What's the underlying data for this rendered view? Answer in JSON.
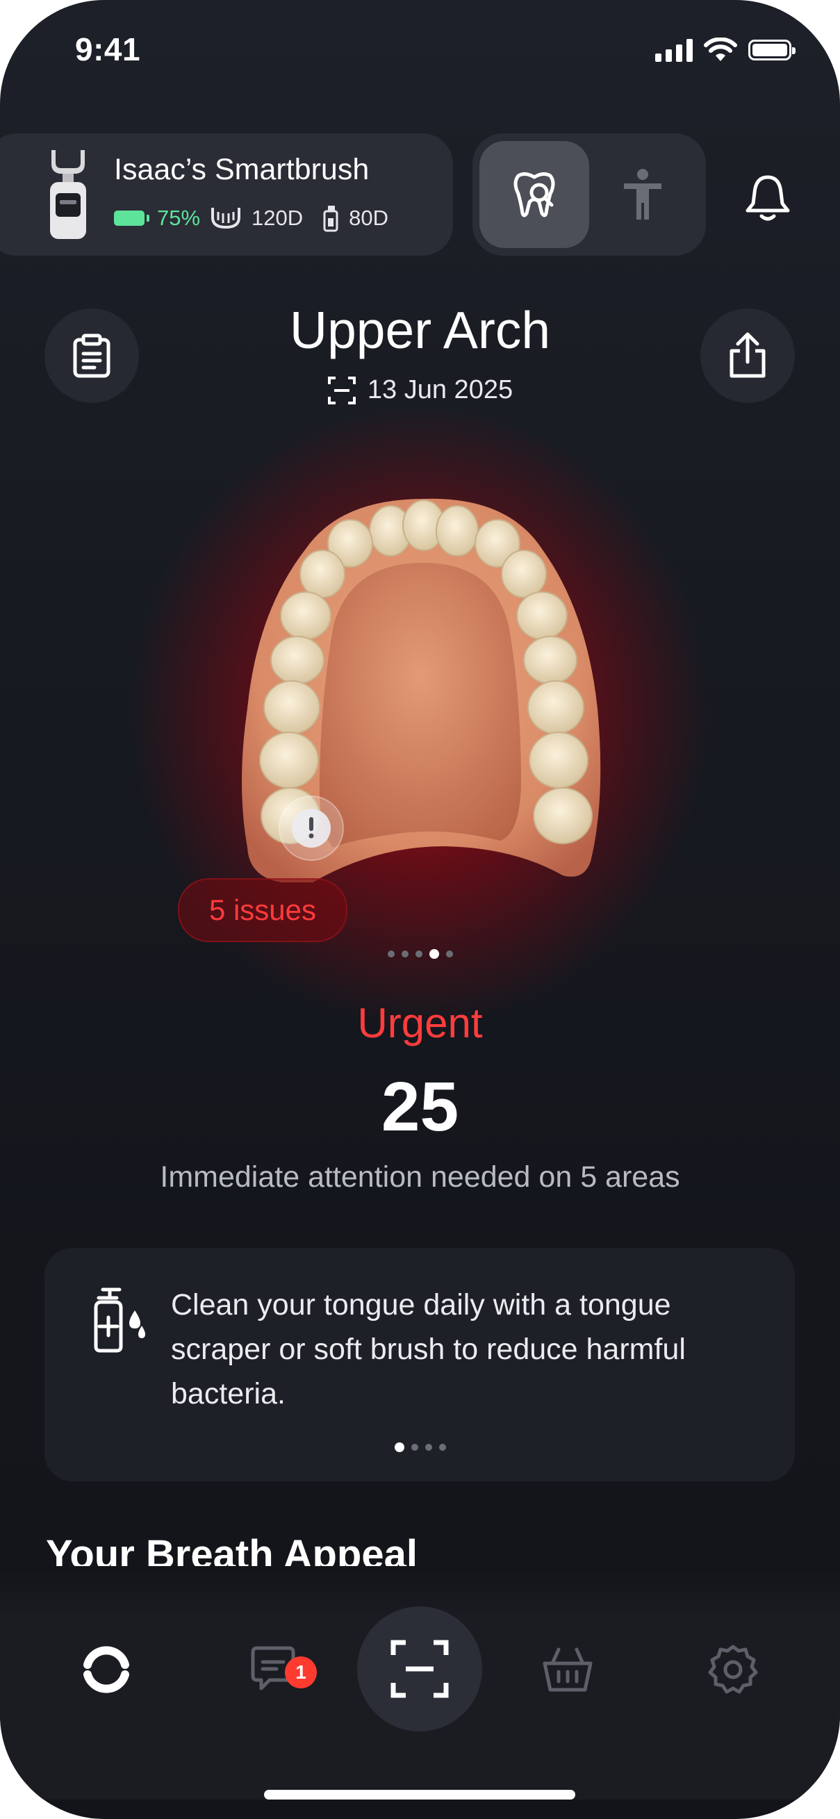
{
  "status_bar": {
    "time": "9:41"
  },
  "device": {
    "name": "Isaac’s Smartbrush",
    "battery": "75%",
    "head_days": "120D",
    "paste_days": "80D"
  },
  "header": {
    "title": "Upper Arch",
    "date": "13 Jun 2025"
  },
  "arch_view": {
    "issues_label": "5 issues",
    "carousel_pages": 5,
    "carousel_active": 4
  },
  "score": {
    "status": "Urgent",
    "value": "25",
    "description": "Immediate attention needed on 5 areas"
  },
  "tip": {
    "text": "Clean your tongue daily with a tongue scraper or soft brush to reduce harmful bacteria.",
    "pages": 4,
    "active": 1
  },
  "section": {
    "title": "Your Breath Appeal"
  },
  "tabbar": {
    "tabs": [
      "home-icon",
      "chat-icon",
      "scan-icon",
      "basket-icon",
      "gear-icon"
    ],
    "chat_badge": "1"
  },
  "colors": {
    "accent_red": "#ff3d3d",
    "battery_green": "#5ee39a",
    "background": "#16181f"
  }
}
